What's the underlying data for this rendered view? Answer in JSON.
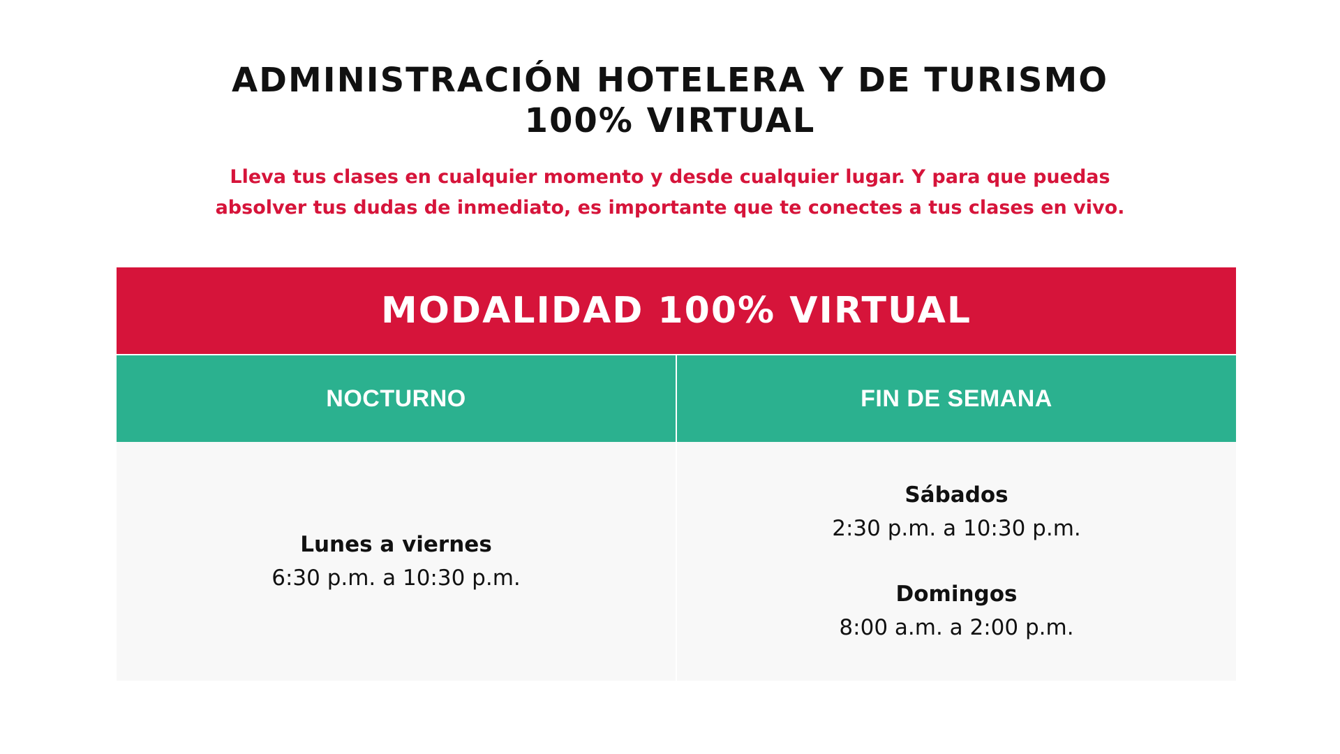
{
  "header": {
    "title_line1": "ADMINISTRACIÓN HOTELERA Y DE TURISMO",
    "title_line2": "100% VIRTUAL",
    "subtitle_line1": "Lleva tus clases en cualquier momento y desde cualquier lugar. Y para que puedas",
    "subtitle_line2": "absolver tus dudas de inmediato, es importante que te conectes a tus clases en vivo."
  },
  "schedule": {
    "title": "MODALIDAD 100% VIRTUAL",
    "columns": [
      {
        "label": "NOCTURNO",
        "slots": [
          {
            "day": "Lunes a viernes",
            "time": "6:30 p.m. a 10:30 p.m."
          }
        ]
      },
      {
        "label": "FIN DE SEMANA",
        "slots": [
          {
            "day": "Sábados",
            "time": "2:30 p.m. a 10:30 p.m."
          },
          {
            "day": "Domingos",
            "time": "8:00 a.m. a 2:00 p.m."
          }
        ]
      }
    ]
  },
  "colors": {
    "accent_red": "#d6143a",
    "accent_green": "#2bb18f",
    "cell_background": "#f8f8f8",
    "text": "#111111"
  }
}
